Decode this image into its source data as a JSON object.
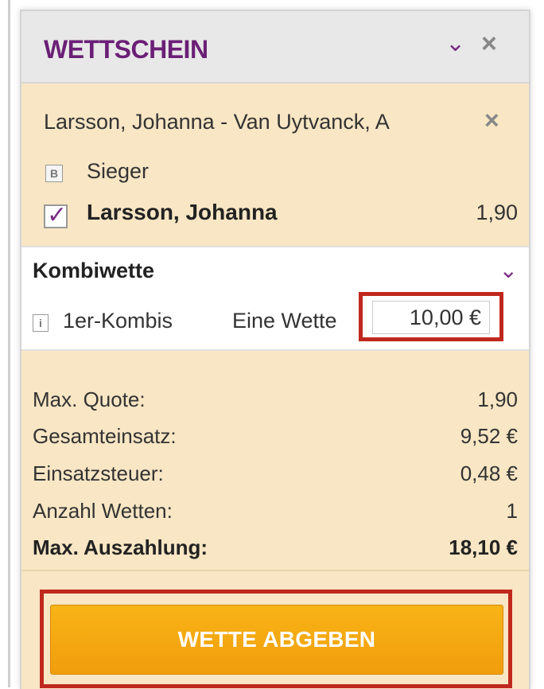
{
  "header": {
    "title": "WETTSCHEIN",
    "collapse_icon": "chevron-down-icon",
    "close_icon": "close-icon"
  },
  "selection": {
    "match": "Larsson, Johanna  -  Van Uytvanck, A",
    "market_badge": "B",
    "market": "Sieger",
    "pick": "Larsson, Johanna",
    "odds": "1,90",
    "checked": true
  },
  "kombi": {
    "title": "Kombiwette",
    "info_badge": "i",
    "type": "1er-Kombis",
    "count": "Eine Wette",
    "stake": "10,00 €"
  },
  "summary": [
    {
      "label": "Max. Quote:",
      "value": "1,90"
    },
    {
      "label": "Gesamteinsatz:",
      "value": "9,52 €"
    },
    {
      "label": "Einsatzsteuer:",
      "value": "0,48 €"
    },
    {
      "label": "Anzahl Wetten:",
      "value": "1"
    },
    {
      "label": "Max. Auszahlung:",
      "value": "18,10 €"
    }
  ],
  "submit_label": "WETTE ABGEBEN",
  "colors": {
    "accent": "#6b1f76",
    "panel_bg": "#f8e6c4",
    "button": "#f4a711",
    "highlight": "#c0281d"
  }
}
